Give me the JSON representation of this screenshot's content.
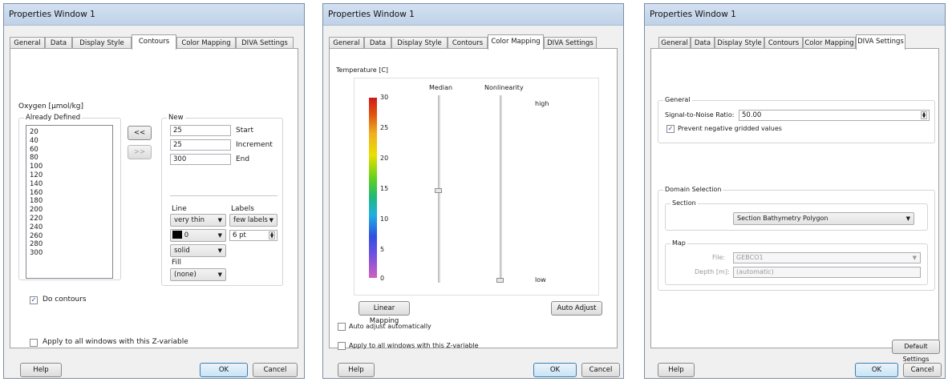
{
  "windows": [
    {
      "title": "Properties Window 1",
      "tabs": [
        "General",
        "Data",
        "Display Style",
        "Contours",
        "Color Mapping",
        "DIVA Settings"
      ],
      "active_tab": "Contours",
      "variable_label": "Oxygen [µmol/kg]",
      "already_defined_label": "Already Defined",
      "already_defined_values": [
        "20",
        "40",
        "60",
        "80",
        "100",
        "120",
        "140",
        "160",
        "180",
        "200",
        "220",
        "240",
        "260",
        "280",
        "300"
      ],
      "move_left_button": "<<",
      "move_right_button": ">>",
      "new_label": "New",
      "start_value": "25",
      "start_label": "Start",
      "increment_value": "25",
      "increment_label": "Increment",
      "end_value": "300",
      "end_label": "End",
      "line_label": "Line",
      "line_width": "very thin",
      "line_color_value": "0",
      "line_style": "solid",
      "labels_label": "Labels",
      "labels_mode": "few labels",
      "labels_size": "6 pt",
      "fill_label": "Fill",
      "fill_value": "(none)",
      "do_contours_label": "Do contours",
      "do_contours_checked": true,
      "apply_all_label": "Apply to all windows with this Z-variable",
      "apply_all_checked": false,
      "help_button": "Help",
      "ok_button": "OK",
      "cancel_button": "Cancel"
    },
    {
      "title": "Properties Window 1",
      "tabs": [
        "General",
        "Data",
        "Display Style",
        "Contours",
        "Color Mapping",
        "DIVA Settings"
      ],
      "active_tab": "Color Mapping",
      "variable_label": "Temperature [C]",
      "scale_ticks": [
        "30",
        "25",
        "20",
        "15",
        "10",
        "5",
        "0"
      ],
      "median_label": "Median",
      "median_level": 0.53,
      "nonlinearity_label": "Nonlinearity",
      "nonlinearity_level": 0.0,
      "high_label": "high",
      "low_label": "low",
      "linear_mapping_button": "Linear Mapping",
      "auto_adjust_button": "Auto Adjust",
      "auto_adjust_auto_label": "Auto adjust automatically",
      "apply_all_label": "Apply to all windows with this Z-variable",
      "help_button": "Help",
      "ok_button": "OK",
      "cancel_button": "Cancel"
    },
    {
      "title": "Properties Window 1",
      "tabs": [
        "General",
        "Data",
        "Display Style",
        "Contours",
        "Color Mapping",
        "DIVA Settings"
      ],
      "active_tab": "DIVA Settings",
      "general_label": "General",
      "snr_label": "Signal-to-Noise Ratio:",
      "snr_value": "50.00",
      "prevent_negative_label": "Prevent negative gridded values",
      "prevent_negative_checked": true,
      "domain_selection_label": "Domain Selection",
      "section_label": "Section",
      "section_value": "Section Bathymetry Polygon",
      "map_label": "Map",
      "file_label": "File:",
      "file_value": "GEBCO1",
      "depth_label": "Depth [m]:",
      "depth_value": "(automatic)",
      "default_settings_button": "Default Settings",
      "help_button": "Help",
      "ok_button": "OK",
      "cancel_button": "Cancel"
    }
  ],
  "colors": {
    "title_bar": "#c8d8ec",
    "panel_bg": "#ffffff",
    "dialog_bg": "#f0f0f0",
    "ok_accent": "#3c7fb1",
    "color_scale_top": "#d01818",
    "color_scale_bottom": "#d060c0"
  }
}
